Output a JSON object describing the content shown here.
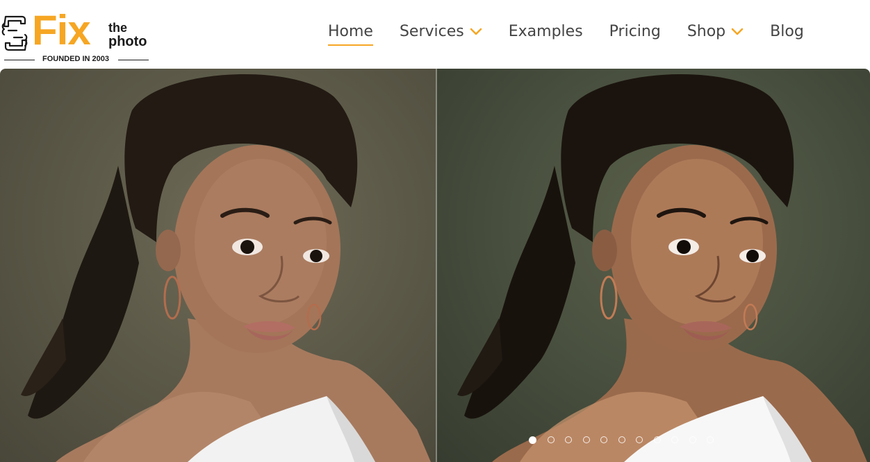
{
  "brand": {
    "logo_main": "Fix",
    "logo_the": "the",
    "logo_photo": "photo",
    "founded": "FOUNDED IN 2003",
    "accent_color": "#f6a623"
  },
  "nav": {
    "items": [
      {
        "label": "Home",
        "active": true,
        "has_dropdown": false
      },
      {
        "label": "Services",
        "active": false,
        "has_dropdown": true
      },
      {
        "label": "Examples",
        "active": false,
        "has_dropdown": false
      },
      {
        "label": "Pricing",
        "active": false,
        "has_dropdown": false
      },
      {
        "label": "Shop",
        "active": false,
        "has_dropdown": true
      },
      {
        "label": "Blog",
        "active": false,
        "has_dropdown": false
      }
    ]
  },
  "slider": {
    "slide_count": 11,
    "active_index": 0,
    "images": [
      "before-portrait",
      "after-portrait"
    ]
  }
}
